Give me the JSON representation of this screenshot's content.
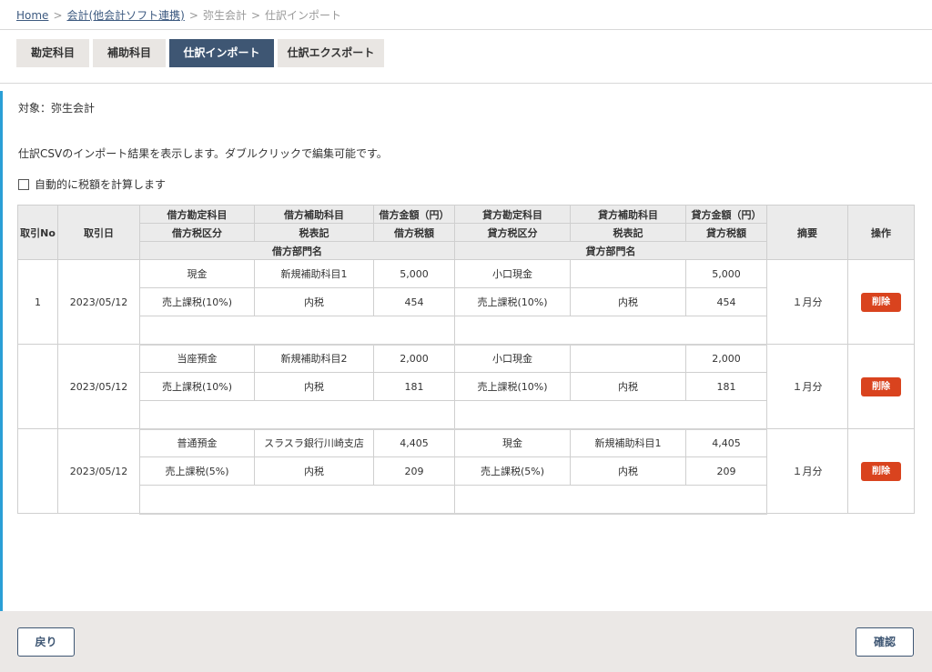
{
  "breadcrumb": {
    "home": "Home",
    "accounting": "会計(他会計ソフト連携)",
    "yayoi": "弥生会計",
    "current": "仕訳インポート",
    "sep": ">"
  },
  "tabs": {
    "account": "勘定科目",
    "sub_account": "補助科目",
    "journal_import": "仕訳インポート",
    "journal_export": "仕訳エクスポート"
  },
  "target_label": "対象：弥生会計",
  "description": "仕訳CSVのインポート結果を表示します。ダブルクリックで編集可能です。",
  "auto_calc_label": "自動的に税額を計算します",
  "table_headers": {
    "txn_no": "取引No",
    "txn_date": "取引日",
    "debit_account": "借方勘定科目",
    "debit_sub": "借方補助科目",
    "debit_amount": "借方金額（円）",
    "credit_account": "貸方勘定科目",
    "credit_sub": "貸方補助科目",
    "credit_amount": "貸方金額（円）",
    "memo": "摘要",
    "ops": "操作",
    "debit_tax_cat": "借方税区分",
    "tax_note": "税表記",
    "debit_tax": "借方税額",
    "credit_tax_cat": "貸方税区分",
    "tax_note2": "税表記",
    "credit_tax": "貸方税額",
    "debit_dept": "借方部門名",
    "credit_dept": "貸方部門名"
  },
  "rows": [
    {
      "no": "1",
      "date": "2023/05/12",
      "debit_account": "現金",
      "debit_sub": "新規補助科目1",
      "debit_amount": "5,000",
      "credit_account": "小口現金",
      "credit_sub": "",
      "credit_amount": "5,000",
      "debit_tax_cat": "売上課税(10%)",
      "debit_tax_note": "内税",
      "debit_tax": "454",
      "credit_tax_cat": "売上課税(10%)",
      "credit_tax_note": "内税",
      "credit_tax": "454",
      "debit_dept": "",
      "credit_dept": "",
      "memo": "１月分",
      "delete_label": "削除"
    },
    {
      "no": "",
      "date": "2023/05/12",
      "debit_account": "当座預金",
      "debit_sub": "新規補助科目2",
      "debit_amount": "2,000",
      "credit_account": "小口現金",
      "credit_sub": "",
      "credit_amount": "2,000",
      "debit_tax_cat": "売上課税(10%)",
      "debit_tax_note": "内税",
      "debit_tax": "181",
      "credit_tax_cat": "売上課税(10%)",
      "credit_tax_note": "内税",
      "credit_tax": "181",
      "debit_dept": "",
      "credit_dept": "",
      "memo": "１月分",
      "delete_label": "削除"
    },
    {
      "no": "",
      "date": "2023/05/12",
      "debit_account": "普通預金",
      "debit_sub": "スラスラ銀行川崎支店",
      "debit_amount": "4,405",
      "credit_account": "現金",
      "credit_sub": "新規補助科目1",
      "credit_amount": "4,405",
      "debit_tax_cat": "売上課税(5%)",
      "debit_tax_note": "内税",
      "debit_tax": "209",
      "credit_tax_cat": "売上課税(5%)",
      "credit_tax_note": "内税",
      "credit_tax": "209",
      "debit_dept": "",
      "credit_dept": "",
      "memo": "１月分",
      "delete_label": "削除"
    }
  ],
  "footer": {
    "back": "戻り",
    "confirm": "確認"
  }
}
